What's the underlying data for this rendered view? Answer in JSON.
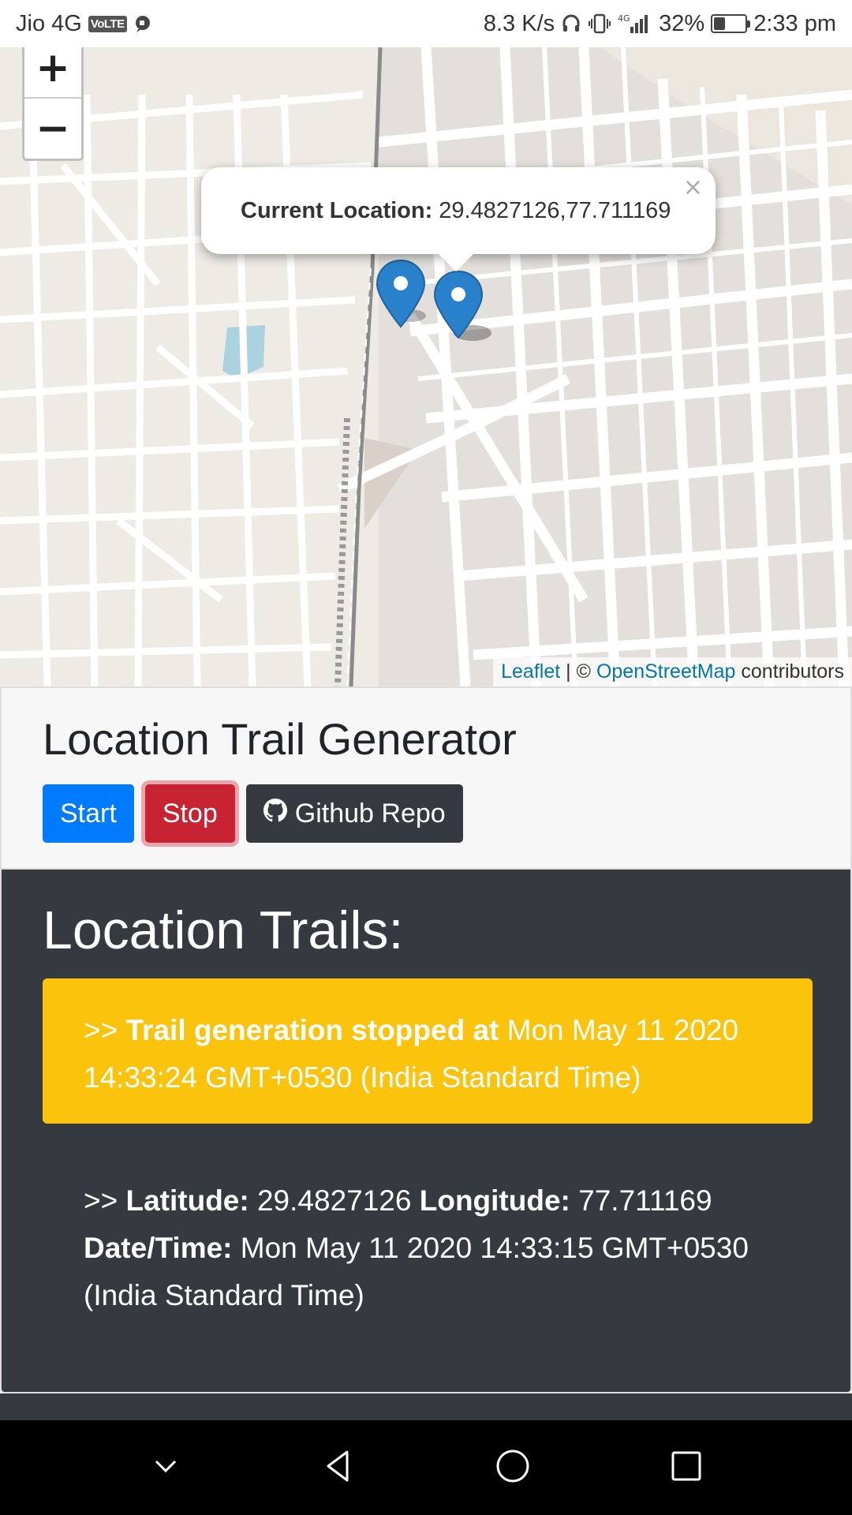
{
  "status_bar": {
    "carrier": "Jio 4G",
    "volte": "VoLTE",
    "speed": "8.3 K/s",
    "network": "4G",
    "battery": "32%",
    "battery_level": 0.32,
    "time": "2:33 pm",
    "icons": [
      "chat-icon",
      "headphones-icon",
      "vibrate-icon",
      "signal-icon",
      "battery-icon"
    ]
  },
  "map": {
    "zoom_in_label": "+",
    "zoom_out_label": "−",
    "popup": {
      "label": "Current Location:",
      "value": "29.4827126,77.711169",
      "close": "×"
    },
    "attribution": {
      "leaflet": "Leaflet",
      "separator": " | © ",
      "osm": "OpenStreetMap",
      "contributors": " contributors"
    },
    "colors": {
      "marker": "#2a81cb",
      "link": "#0078a8",
      "land": "#eeebe5",
      "road": "#ffffff"
    }
  },
  "header": {
    "title": "Location Trail Generator",
    "start_label": "Start",
    "stop_label": "Stop",
    "github_label": "Github Repo"
  },
  "trails": {
    "title": "Location Trails:",
    "alert": {
      "prefix": ">> ",
      "bold": "Trail generation stopped at",
      "text": " Mon May 11 2020 14:33:24 GMT+0530 (India Standard Time)"
    },
    "entries": [
      {
        "prefix": ">> ",
        "lat_label": "Latitude:",
        "lat": " 29.4827126 ",
        "lon_label": "Longitude:",
        "lon": " 77.711169",
        "dt_label": "Date/Time:",
        "dt": " Mon May 11 2020 14:33:15 GMT+0530 (India Standard Time)"
      }
    ]
  },
  "colors": {
    "start": "#007bff",
    "stop": "#c82333",
    "github": "#343a40",
    "alert": "#fbc30c",
    "dark": "#343a40"
  }
}
